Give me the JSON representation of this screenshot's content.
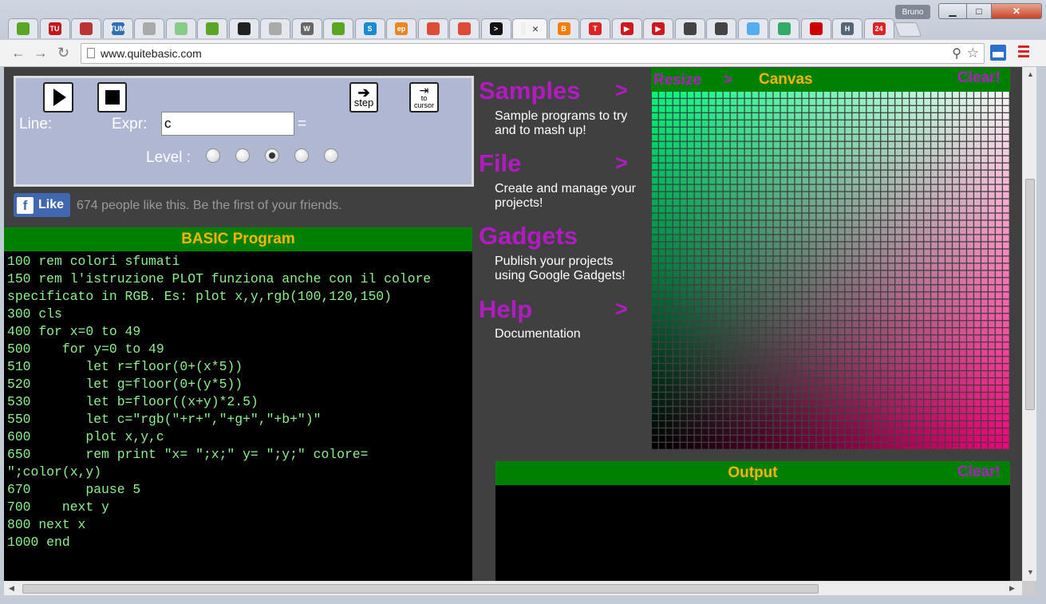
{
  "browser": {
    "user": "Bruno",
    "url": "www.quitebasic.com",
    "tabs": [
      {
        "icon": "evernote",
        "color": "#5ba525",
        "glyph": ""
      },
      {
        "icon": "tu",
        "color": "#c4161c",
        "glyph": "TU"
      },
      {
        "icon": "shield-red",
        "color": "#b33",
        "glyph": ""
      },
      {
        "icon": "tum",
        "color": "#3070b3",
        "glyph": "TUM"
      },
      {
        "icon": "page",
        "color": "#aaa",
        "glyph": ""
      },
      {
        "icon": "green-square",
        "color": "#8c8",
        "glyph": ""
      },
      {
        "icon": "evernote",
        "color": "#5ba525",
        "glyph": ""
      },
      {
        "icon": "dark-square",
        "color": "#222",
        "glyph": ""
      },
      {
        "icon": "page",
        "color": "#aaa",
        "glyph": ""
      },
      {
        "icon": "wikipedia",
        "color": "#666",
        "glyph": "W"
      },
      {
        "icon": "evernote",
        "color": "#5ba525",
        "glyph": ""
      },
      {
        "icon": "s-blue",
        "color": "#1c8ad0",
        "glyph": "S"
      },
      {
        "icon": "ep",
        "color": "#e8862a",
        "glyph": "ep"
      },
      {
        "icon": "chrome",
        "color": "#dd4b39",
        "glyph": ""
      },
      {
        "icon": "chrome",
        "color": "#dd4b39",
        "glyph": ""
      },
      {
        "icon": "terminal",
        "color": "#111",
        "glyph": ">"
      },
      {
        "icon": "active-blank",
        "color": "#eee",
        "glyph": ""
      },
      {
        "icon": "blogger",
        "color": "#f57d00",
        "glyph": "B"
      },
      {
        "icon": "t-red",
        "color": "#d22",
        "glyph": "T"
      },
      {
        "icon": "youtube",
        "color": "#cc181e",
        "glyph": "▶"
      },
      {
        "icon": "youtube",
        "color": "#cc181e",
        "glyph": "▶"
      },
      {
        "icon": "ink",
        "color": "#444",
        "glyph": ""
      },
      {
        "icon": "ink",
        "color": "#444",
        "glyph": ""
      },
      {
        "icon": "twitter",
        "color": "#55acee",
        "glyph": ""
      },
      {
        "icon": "globe",
        "color": "#3a6",
        "glyph": ""
      },
      {
        "icon": "pdf",
        "color": "#c00",
        "glyph": ""
      },
      {
        "icon": "h-hist",
        "color": "#567",
        "glyph": "H"
      },
      {
        "icon": "24",
        "color": "#d22",
        "glyph": "24"
      }
    ],
    "active_tab_close": "×"
  },
  "debugger": {
    "step_label": "step",
    "cursor_label_top": "to",
    "cursor_label_bottom": "cursor",
    "line_label": "Line:",
    "expr_label": "Expr:",
    "expr_value": "c",
    "equals": "=",
    "level_label": "Level :",
    "level_selected_index": 2
  },
  "facebook": {
    "like_label": "Like",
    "like_text": "674 people like this. Be the first of your friends."
  },
  "program": {
    "header": "BASIC Program",
    "lines": [
      "100 rem colori sfumati",
      "150 rem l'istruzione PLOT funziona anche con il colore specificato in RGB. Es: plot x,y,rgb(100,120,150)",
      "300 cls",
      "400 for x=0 to 49",
      "500    for y=0 to 49",
      "510       let r=floor(0+(x*5))",
      "520       let g=floor(0+(y*5))",
      "530       let b=floor((x+y)*2.5)",
      "550       let c=\"rgb(\"+r+\",\"+g+\",\"+b+\")\"",
      "600       plot x,y,c",
      "650       rem print \"x= \";x;\" y= \";y;\" colore= \";color(x,y)",
      "670       pause 5",
      "700    next y",
      "800 next x",
      "1000 end"
    ]
  },
  "menu": {
    "items": [
      {
        "title": "Samples",
        "arrow": ">",
        "desc": "Sample programs to try and to mash up!"
      },
      {
        "title": "File",
        "arrow": ">",
        "desc": "Create and manage your projects!"
      },
      {
        "title": "Gadgets",
        "arrow": "",
        "desc": "Publish your projects using Google Gadgets!"
      },
      {
        "title": "Help",
        "arrow": ">",
        "desc": "Documentation"
      }
    ]
  },
  "canvas": {
    "resize_label": "Resize",
    "resize_arrow": ">",
    "header": "Canvas",
    "clear_label": "Clear!",
    "grid_size": 50
  },
  "output": {
    "header": "Output",
    "clear_label": "Clear!"
  },
  "colors": {
    "accent_purple": "#b31bc2",
    "header_green": "#008000",
    "header_text": "#ffb400",
    "code_text": "#8ef08e"
  }
}
